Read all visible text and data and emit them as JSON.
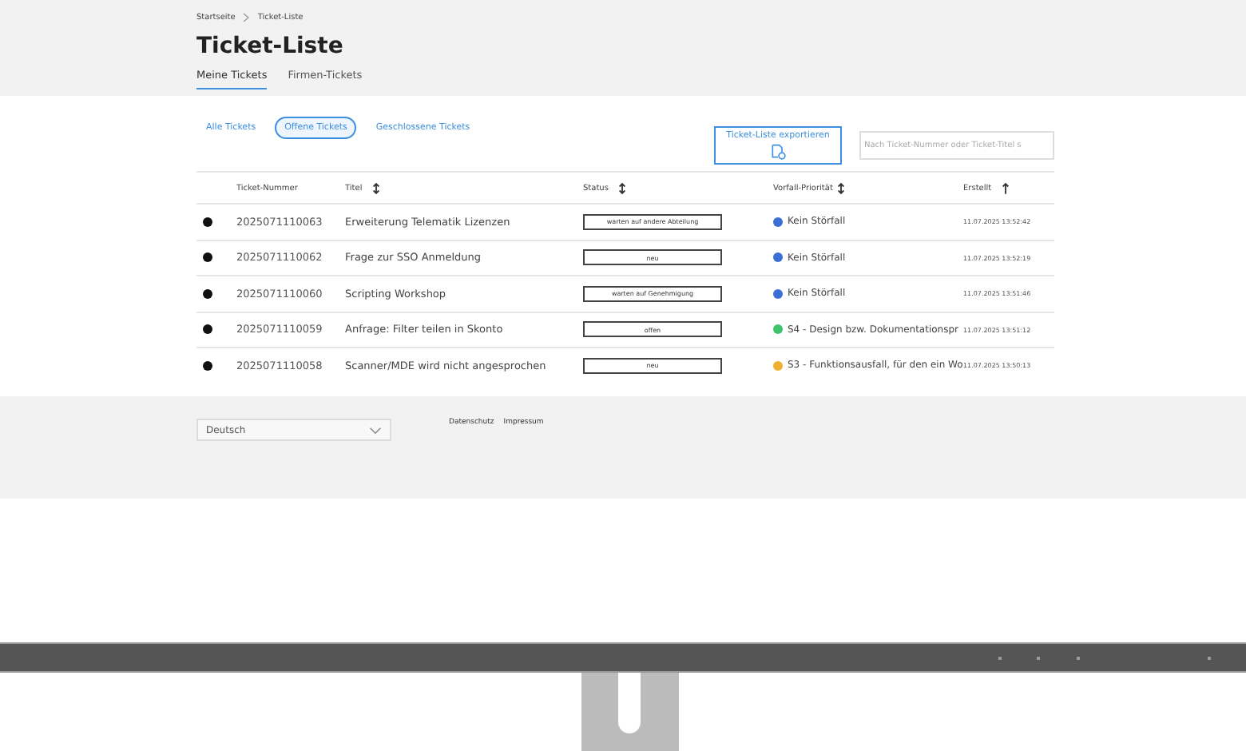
{
  "breadcrumb": [
    "Startseite",
    "Ticket-Liste"
  ],
  "page_title": "Ticket-Liste",
  "tabs": [
    {
      "label": "Meine Tickets",
      "selected": true
    },
    {
      "label": "Firmen-Tickets",
      "selected": false
    }
  ],
  "filters": [
    {
      "label": "Alle Tickets",
      "selected": false
    },
    {
      "label": "Offene Tickets",
      "selected": true
    },
    {
      "label": "Geschlossene Tickets",
      "selected": false
    }
  ],
  "export_button": "Ticket-Liste exportieren",
  "search": {
    "placeholder": "Nach Ticket-Nummer oder Ticket-Titel s"
  },
  "table": {
    "columns": [
      {
        "label": "Ticket-Nummer",
        "kind": "plain"
      },
      {
        "label": "Titel",
        "kind": "sortable"
      },
      {
        "label": "Status",
        "kind": "sortable"
      },
      {
        "label": "Vorfall-Priorität",
        "kind": "sortable"
      },
      {
        "label": "Erstellt",
        "kind": "ascending"
      }
    ],
    "rows": [
      {
        "number": "2025071110063",
        "title": "Erweiterung Telematik Lizenzen",
        "status": "warten auf andere Abteilung",
        "priority": "Kein Störfall",
        "color": "#3b6fd6",
        "created": "11.07.2025 13:52:42"
      },
      {
        "number": "2025071110062",
        "title": "Frage zur SSO Anmeldung",
        "status": "neu",
        "priority": "Kein Störfall",
        "color": "#3b6fd6",
        "created": "11.07.2025 13:52:19"
      },
      {
        "number": "2025071110060",
        "title": "Scripting Workshop",
        "status": "warten auf Genehmigung",
        "priority": "Kein Störfall",
        "color": "#3b6fd6",
        "created": "11.07.2025 13:51:46"
      },
      {
        "number": "2025071110059",
        "title": "Anfrage: Filter teilen in Skonto",
        "status": "offen",
        "priority": "S4 - Design bzw. Dokumentationspr",
        "color": "#3cc46a",
        "created": "11.07.2025 13:51:12"
      },
      {
        "number": "2025071110058",
        "title": "Scanner/MDE wird nicht angesprochen",
        "status": "neu",
        "priority": "S3 - Funktionsausfall, für den ein Wo",
        "color": "#eeb12e",
        "created": "11.07.2025 13:50:13"
      }
    ]
  },
  "footer": {
    "language": "Deutsch",
    "links": [
      "Datenschutz",
      "Impressum"
    ]
  }
}
